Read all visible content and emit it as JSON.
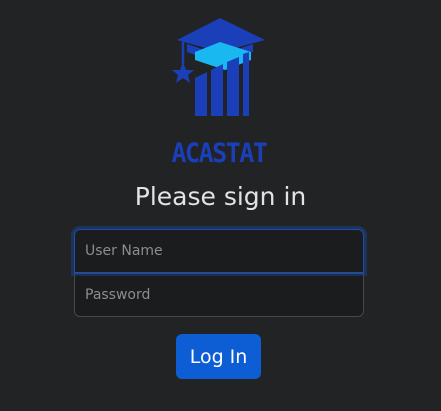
{
  "brand": {
    "name": "ACASTAT",
    "logo_icon": "graduation-cap-bar-chart-star-icon",
    "colors": {
      "dark_blue": "#1a3fb8",
      "light_blue": "#1ab8f0"
    }
  },
  "heading": "Please sign in",
  "form": {
    "username_placeholder": "User Name",
    "password_placeholder": "Password",
    "username_value": "",
    "password_value": ""
  },
  "login_button": {
    "label": "Log In",
    "color": "#0d5dd4"
  },
  "theme": {
    "background": "#212325",
    "text": "#e2e3e5"
  }
}
